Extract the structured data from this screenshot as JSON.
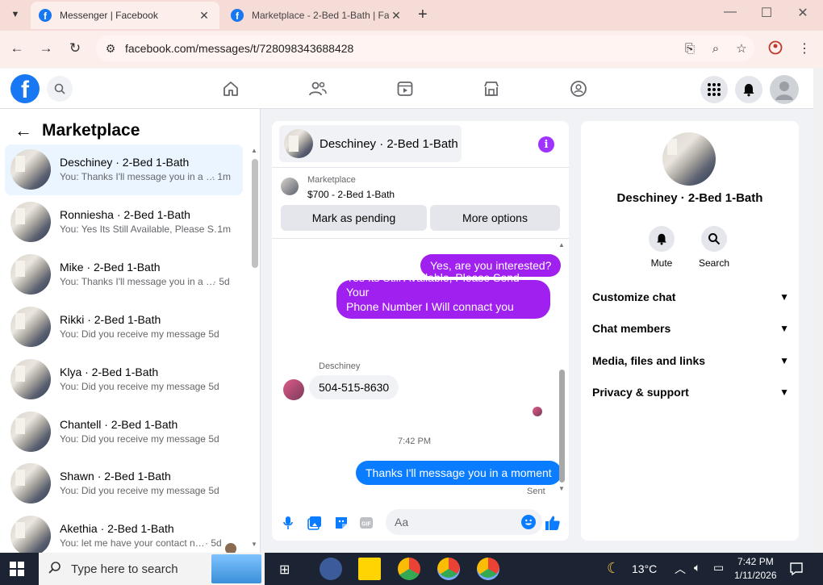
{
  "browser": {
    "tabs": [
      {
        "title": "Messenger | Facebook",
        "active": true
      },
      {
        "title": "Marketplace - 2-Bed 1-Bath | Fa",
        "active": false
      }
    ],
    "url": "facebook.com/messages/t/728098343688428",
    "accent": "#f6dcd6"
  },
  "fb": {
    "brand_color": "#1877f2",
    "logo_letter": "f",
    "nav_icons": [
      "home-icon",
      "friends-icon",
      "watch-icon",
      "marketplace-icon",
      "groups-icon"
    ],
    "right_icons": [
      "menu-grid-icon",
      "bell-icon",
      "profile-avatar"
    ]
  },
  "left": {
    "title": "Marketplace",
    "conversations": [
      {
        "name": "Deschiney · 2-Bed 1-Bath",
        "preview": "You: Thanks I'll message you in a …",
        "time": "· 1m",
        "selected": true
      },
      {
        "name": "Ronniesha · 2-Bed 1-Bath",
        "preview": "You: Yes Its Still Available, Please S…",
        "time": "· 1m"
      },
      {
        "name": "Mike · 2-Bed 1-Bath",
        "preview": "You: Thanks I'll message you in a …",
        "time": "· 5d"
      },
      {
        "name": "Rikki · 2-Bed 1-Bath",
        "preview": "You: Did you receive my message",
        "time": "· 5d"
      },
      {
        "name": "Klya · 2-Bed 1-Bath",
        "preview": "You: Did you receive my message",
        "time": "· 5d"
      },
      {
        "name": "Chantell · 2-Bed 1-Bath",
        "preview": "You: Did you receive my message",
        "time": "· 5d"
      },
      {
        "name": "Shawn · 2-Bed 1-Bath",
        "preview": "You: Did you receive my message",
        "time": "· 5d"
      },
      {
        "name": "Akethia · 2-Bed 1-Bath",
        "preview": "You: let me have your contact n…",
        "time": "· 5d"
      }
    ]
  },
  "chat": {
    "header_name": "Deschiney · 2-Bed 1-Bath",
    "listing_label": "Marketplace",
    "listing_price": "$700 - 2-Bed 1-Bath",
    "btn_pending": "Mark as pending",
    "btn_more": "More options",
    "msg1": "Yes, are you interested?",
    "msg2_line1": "Yes Its Still Available, Please Send Your",
    "msg2_line2": "Phone Number I Will connact you soon",
    "sender": "Deschiney",
    "msg3": "504-515-8630",
    "timestamp": "7:42 PM",
    "msg4": "Thanks I'll message you in a moment",
    "status": "Sent",
    "composer_placeholder": "Aa",
    "outgoing_color": "#0a7cff",
    "purple_color": "#a020f0"
  },
  "right": {
    "name": "Deschiney · 2-Bed 1-Bath",
    "mute": "Mute",
    "search": "Search",
    "sections": [
      "Customize chat",
      "Chat members",
      "Media, files and links",
      "Privacy & support"
    ]
  },
  "taskbar": {
    "search_placeholder": "Type here to search",
    "weather": "13°C",
    "time": "7:42 PM",
    "date": "1/11/2026"
  }
}
